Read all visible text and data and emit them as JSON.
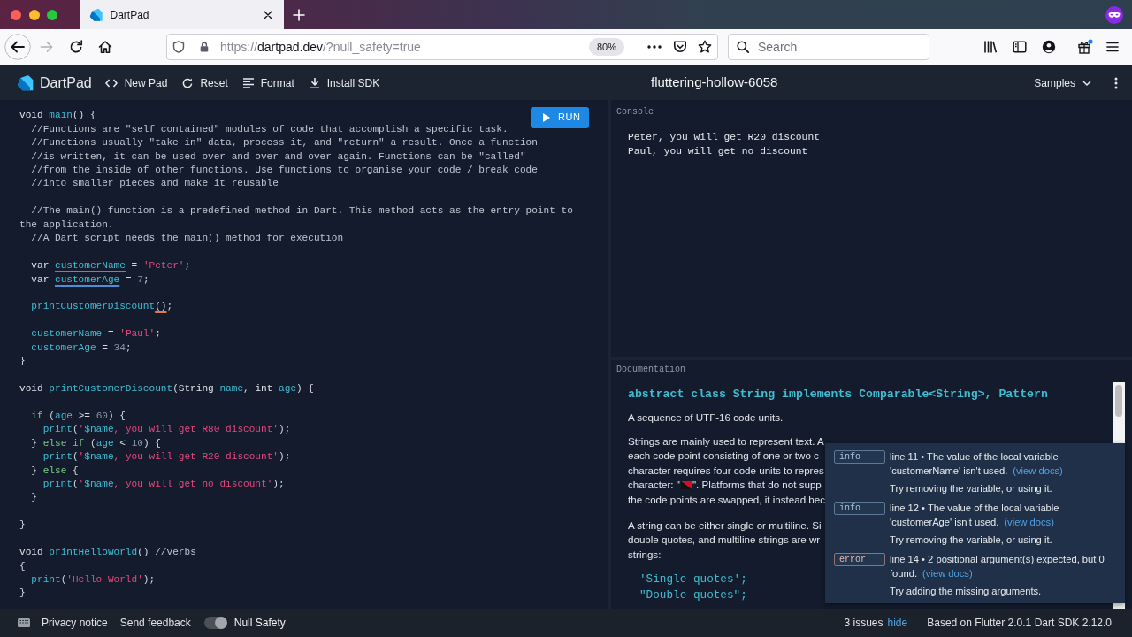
{
  "browser": {
    "tabs": [
      {
        "title": "DartPad",
        "selected": true
      }
    ],
    "nav_buttons": [
      {
        "kind": "back",
        "disabled": false
      },
      {
        "kind": "forward",
        "disabled": true
      },
      {
        "kind": "reload",
        "disabled": false
      },
      {
        "kind": "home",
        "disabled": false
      }
    ],
    "address": [
      {
        "text": "https://",
        "host": false
      },
      {
        "text": "dartpad.dev",
        "host": true
      },
      {
        "text": "/?null_safety=true",
        "host": false
      }
    ],
    "zoom": "80%",
    "search": {
      "placeholder": "Search"
    }
  },
  "app_bar": {
    "name": "DartPad",
    "actions": [
      {
        "kind": "new",
        "label": "New Pad"
      },
      {
        "kind": "reset",
        "label": "Reset"
      },
      {
        "kind": "format",
        "label": "Format"
      },
      {
        "kind": "install",
        "label": "Install SDK"
      }
    ],
    "title": "fluttering-hollow-6058",
    "samples": "Samples"
  },
  "editor": {
    "run": "RUN",
    "blocks": [
      [
        [
          {
            "text": "void",
            "kind": "keyword"
          },
          {
            "text": " main",
            "kind": "identifier"
          },
          {
            "text": "() {",
            "kind": "punctuation"
          }
        ],
        [
          {
            "text": "  //Functions are \"self contained\" modules of code that accomplish a specific task.",
            "kind": "comment"
          }
        ],
        [
          {
            "text": "  //Functions usually \"take in\" data, process it, and \"return\" a result. Once a function",
            "kind": "comment"
          }
        ],
        [
          {
            "text": "  //is written, it can be used over and over and over again. Functions can be \"called\"",
            "kind": "comment"
          }
        ],
        [
          {
            "text": "  //from the inside of other functions. Use functions to organise your code / break code",
            "kind": "comment"
          }
        ],
        [
          {
            "text": "  //into smaller pieces and make it reusable",
            "kind": "comment"
          }
        ]
      ],
      [
        [
          {
            "text": "  //The main() function is a predefined method in Dart. This method acts as the entry point to the application.",
            "kind": "comment"
          }
        ],
        [
          {
            "text": "  //A Dart script needs the main() method for execution",
            "kind": "comment"
          }
        ]
      ],
      [
        [
          {
            "text": "  var",
            "kind": "keyword"
          },
          {
            "text": " customerName",
            "kind": "identifier",
            "underlined": true,
            "error": false
          },
          {
            "text": " =",
            "kind": "punctuation"
          },
          {
            "text": " 'Peter'",
            "kind": "string"
          },
          {
            "text": ";",
            "kind": "punctuation"
          }
        ],
        [
          {
            "text": "  var",
            "kind": "keyword"
          },
          {
            "text": " customerAge",
            "kind": "identifier",
            "underlined": true,
            "error": false
          },
          {
            "text": " =",
            "kind": "punctuation"
          },
          {
            "text": " 7",
            "kind": "number"
          },
          {
            "text": ";",
            "kind": "punctuation"
          }
        ]
      ],
      [
        [
          {
            "text": "  printCustomerDiscount",
            "kind": "identifier"
          },
          {
            "text": "()",
            "kind": "punctuation",
            "underlined": true,
            "error": true
          },
          {
            "text": ";",
            "kind": "punctuation"
          }
        ]
      ],
      [
        [
          {
            "text": "  customerName",
            "kind": "identifier"
          },
          {
            "text": " =",
            "kind": "punctuation"
          },
          {
            "text": " 'Paul'",
            "kind": "string"
          },
          {
            "text": ";",
            "kind": "punctuation"
          }
        ],
        [
          {
            "text": "  customerAge",
            "kind": "identifier"
          },
          {
            "text": " =",
            "kind": "punctuation"
          },
          {
            "text": " 34",
            "kind": "number"
          },
          {
            "text": ";",
            "kind": "punctuation"
          }
        ],
        [
          {
            "text": "}",
            "kind": "punctuation"
          }
        ]
      ],
      [
        [
          {
            "text": "void",
            "kind": "keyword"
          },
          {
            "text": " printCustomerDiscount",
            "kind": "identifier"
          },
          {
            "text": "(",
            "kind": "punctuation"
          },
          {
            "text": "String",
            "kind": "keyword"
          },
          {
            "text": " name",
            "kind": "identifier"
          },
          {
            "text": ",",
            "kind": "punctuation"
          },
          {
            "text": " int",
            "kind": "keyword"
          },
          {
            "text": " age",
            "kind": "identifier"
          },
          {
            "text": ") {",
            "kind": "punctuation"
          }
        ]
      ],
      [
        [
          {
            "text": "  if",
            "kind": "control"
          },
          {
            "text": " (",
            "kind": "punctuation"
          },
          {
            "text": "age",
            "kind": "identifier"
          },
          {
            "text": " >=",
            "kind": "punctuation"
          },
          {
            "text": " 60",
            "kind": "number"
          },
          {
            "text": ") {",
            "kind": "punctuation"
          }
        ],
        [
          {
            "text": "    print",
            "kind": "identifier"
          },
          {
            "text": "(",
            "kind": "punctuation"
          },
          {
            "text": "'",
            "kind": "string"
          },
          {
            "text": "$name",
            "kind": "identifier"
          },
          {
            "text": ", you will get R80 discount'",
            "kind": "string"
          },
          {
            "text": ");",
            "kind": "punctuation"
          }
        ],
        [
          {
            "text": "  }",
            "kind": "punctuation"
          },
          {
            "text": " else if",
            "kind": "control"
          },
          {
            "text": " (",
            "kind": "punctuation"
          },
          {
            "text": "age",
            "kind": "identifier"
          },
          {
            "text": " <",
            "kind": "punctuation"
          },
          {
            "text": " 10",
            "kind": "number"
          },
          {
            "text": ") {",
            "kind": "punctuation"
          }
        ],
        [
          {
            "text": "    print",
            "kind": "identifier"
          },
          {
            "text": "(",
            "kind": "punctuation"
          },
          {
            "text": "'",
            "kind": "string"
          },
          {
            "text": "$name",
            "kind": "identifier"
          },
          {
            "text": ", you will get R20 discount'",
            "kind": "string"
          },
          {
            "text": ");",
            "kind": "punctuation"
          }
        ],
        [
          {
            "text": "  }",
            "kind": "punctuation"
          },
          {
            "text": " else",
            "kind": "control"
          },
          {
            "text": " {",
            "kind": "punctuation"
          }
        ],
        [
          {
            "text": "    print",
            "kind": "identifier"
          },
          {
            "text": "(",
            "kind": "punctuation"
          },
          {
            "text": "'",
            "kind": "string"
          },
          {
            "text": "$name",
            "kind": "identifier"
          },
          {
            "text": ", you will get no discount'",
            "kind": "string"
          },
          {
            "text": ");",
            "kind": "punctuation"
          }
        ],
        [
          {
            "text": "  }",
            "kind": "punctuation"
          }
        ]
      ],
      [
        [
          {
            "text": "}",
            "kind": "punctuation"
          }
        ]
      ],
      [
        [
          {
            "text": "void",
            "kind": "keyword"
          },
          {
            "text": " printHelloWorld",
            "kind": "identifier"
          },
          {
            "text": "()",
            "kind": "punctuation"
          },
          {
            "text": " //verbs",
            "kind": "comment"
          }
        ],
        [
          {
            "text": "{",
            "kind": "punctuation"
          }
        ],
        [
          {
            "text": "  print",
            "kind": "identifier"
          },
          {
            "text": "(",
            "kind": "punctuation"
          },
          {
            "text": "'Hello World'",
            "kind": "string"
          },
          {
            "text": ");",
            "kind": "punctuation"
          }
        ],
        [
          {
            "text": "}",
            "kind": "punctuation"
          }
        ]
      ]
    ]
  },
  "console": {
    "label": "Console",
    "lines": [
      "Peter, you will get R20 discount",
      "Paul, you will get no discount"
    ]
  },
  "documentation": {
    "label": "Documentation",
    "heading": "abstract class String implements Comparable<String>, Pattern",
    "paragraphs": [
      {
        "lines": [
          [
            {
              "kind": "text",
              "text": "A sequence of UTF-16 code units."
            }
          ]
        ]
      },
      {
        "lines": [
          [
            {
              "kind": "text",
              "text": "Strings are mainly used to represent text. A"
            }
          ],
          [
            {
              "kind": "text",
              "text": "each code point consisting of one or two c"
            }
          ],
          [
            {
              "kind": "text",
              "text": "character requires four code units to repres"
            }
          ],
          [
            {
              "kind": "text",
              "text": "character: \""
            },
            {
              "kind": "flag"
            },
            {
              "kind": "text",
              "text": "\". Platforms that do not supp"
            }
          ],
          [
            {
              "kind": "text",
              "text": "the code points are swapped, it instead bec"
            }
          ]
        ]
      },
      {
        "lines": [
          [
            {
              "kind": "text",
              "text": "A string can be either single or multiline. Si"
            }
          ],
          [
            {
              "kind": "text",
              "text": "double quotes, and multiline strings are wr"
            }
          ],
          [
            {
              "kind": "text",
              "text": "strings:"
            }
          ]
        ]
      }
    ],
    "code": [
      "'Single quotes';",
      "\"Double quotes\";"
    ]
  },
  "issues": [
    {
      "kind": "info",
      "badge": "info",
      "message": "line 11 • The value of the local variable 'customerName' isn't used.",
      "link": "(view docs)",
      "hint": "Try removing the variable, or using it."
    },
    {
      "kind": "info",
      "badge": "info",
      "message": "line 12 • The value of the local variable 'customerAge' isn't used.",
      "link": "(view docs)",
      "hint": "Try removing the variable, or using it."
    },
    {
      "kind": "error",
      "badge": "error",
      "message": "line 14 • 2 positional argument(s) expected, but 0 found.",
      "link": "(view docs)",
      "hint": "Try adding the missing arguments."
    }
  ],
  "status_bar": {
    "privacy": "Privacy notice",
    "feedback": "Send feedback",
    "null_safety": {
      "label": "Null Safety",
      "on": true
    },
    "issue_count": "3 issues",
    "hide": "hide",
    "version": "Based on Flutter 2.0.1 Dart SDK 2.12.0"
  }
}
